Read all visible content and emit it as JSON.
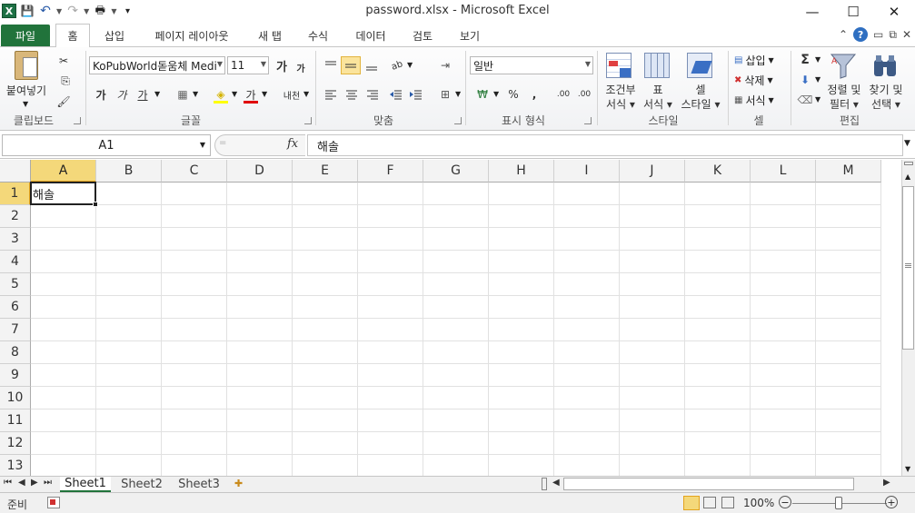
{
  "window": {
    "title": "password.xlsx  -  Microsoft Excel",
    "minimize_glyph": "—",
    "maximize_glyph": "☐",
    "close_glyph": "✕"
  },
  "quick_access": {
    "app_icon": "excel-logo-icon",
    "app_letter": "X",
    "save_glyph": "💾",
    "undo_glyph": "↶",
    "redo_glyph": "↷",
    "print_glyph": "🖶",
    "customize_glyph": "▾"
  },
  "menu_tabs": [
    {
      "label": "파일"
    },
    {
      "label": "홈"
    },
    {
      "label": "삽입"
    },
    {
      "label": "페이지 레이아웃"
    },
    {
      "label": "새 탭"
    },
    {
      "label": "수식"
    },
    {
      "label": "데이터"
    },
    {
      "label": "검토"
    },
    {
      "label": "보기"
    }
  ],
  "ribbon": {
    "clipboard": {
      "paste_label": "붙여넣기",
      "cut_glyph": "✂",
      "copy_glyph": "⎘",
      "format_painter_glyph": "🖌",
      "group_label": "클립보드"
    },
    "font": {
      "font_name": "KoPubWorld돋움체 Medi",
      "font_size": "11",
      "grow_label": "가",
      "shrink_label": "가",
      "bold_label": "가",
      "italic_label": "가",
      "underline_label": "가",
      "border_glyph": "▦",
      "fill_glyph": "◈",
      "font_color_label": "가",
      "phonetic_label": "내천",
      "group_label": "글꼴"
    },
    "alignment": {
      "group_label": "맞춤",
      "wrap_glyph": "⇥",
      "merge_glyph": "⊞",
      "orient_glyph": "ab"
    },
    "number": {
      "format": "일반",
      "currency_glyph": "₩",
      "percent_label": "%",
      "comma_label": ",",
      "inc_decimal_label": ".00",
      "dec_decimal_label": ".00",
      "group_label": "표시 형식"
    },
    "styles": {
      "conditional_label_1": "조건부",
      "conditional_label_2": "서식 ▾",
      "table_label_1": "표",
      "table_label_2": "서식 ▾",
      "cell_label_1": "셀",
      "cell_label_2": "스타일 ▾",
      "group_label": "스타일"
    },
    "cells": {
      "insert_label": "삽입",
      "delete_label": "삭제",
      "format_label": "서식",
      "group_label": "셀"
    },
    "editing": {
      "sum_glyph": "Σ",
      "fill_glyph": "⬇",
      "clear_glyph": "⌫",
      "sort_label_1": "정렬 및",
      "sort_label_2": "필터 ▾",
      "find_label_1": "찾기 및",
      "find_label_2": "선택 ▾",
      "group_label": "편집"
    }
  },
  "formula_bar": {
    "name_box": "A1",
    "fx_label": "fx",
    "content": "해솔"
  },
  "grid": {
    "columns": [
      "A",
      "B",
      "C",
      "D",
      "E",
      "F",
      "G",
      "H",
      "I",
      "J",
      "K",
      "L",
      "M"
    ],
    "rows": [
      "1",
      "2",
      "3",
      "4",
      "5",
      "6",
      "7",
      "8",
      "9",
      "10",
      "11",
      "12",
      "13"
    ],
    "selected_column": "A",
    "selected_row": "1",
    "cells": {
      "A1": "해솔"
    }
  },
  "sheets": [
    {
      "label": "Sheet1"
    },
    {
      "label": "Sheet2"
    },
    {
      "label": "Sheet3"
    }
  ],
  "status": {
    "ready": "준비",
    "zoom": "100%",
    "zoom_minus": "−",
    "zoom_plus": "+"
  },
  "colors": {
    "file_tab": "#21733b",
    "selected_header": "#f4d87a",
    "accent_orange": "#e3a31d"
  }
}
